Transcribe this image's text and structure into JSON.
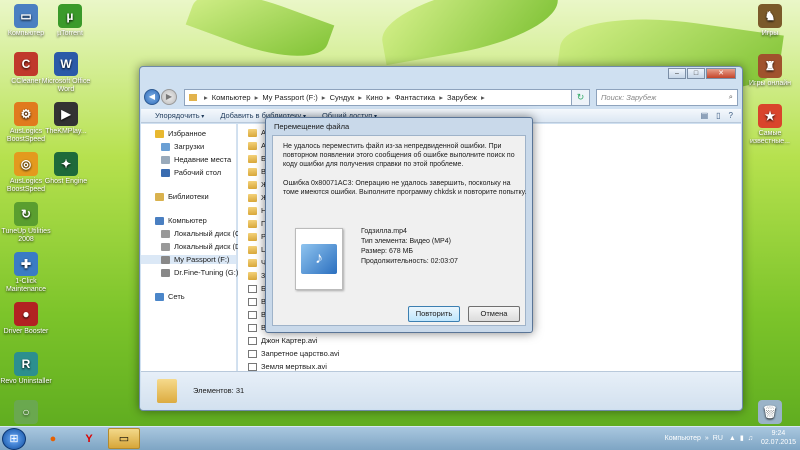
{
  "desktop": {
    "icons_left": [
      {
        "label": "Компьютер",
        "icon": "computer-icon"
      },
      {
        "label": "µTorrent",
        "icon": "utorrent-icon"
      },
      {
        "label": "CCleaner",
        "icon": "ccleaner-icon"
      },
      {
        "label": "Microsoft Office Word",
        "icon": "word-icon"
      },
      {
        "label": "AusLogics BoostSpeed",
        "icon": "boostspeed-icon"
      },
      {
        "label": "TheKMPlay...",
        "icon": "kmplayer-icon"
      },
      {
        "label": "AusLogics BoostSpeed",
        "icon": "boostspeed-icon"
      },
      {
        "label": "Ghost Engine",
        "icon": "ghost-icon"
      },
      {
        "label": "TuneUp Utilities 2008",
        "icon": "tuneup-icon"
      },
      {
        "label": "1-Click Maintenance",
        "icon": "maintenance-icon"
      },
      {
        "label": "Driver Booster",
        "icon": "driverbooster-icon"
      },
      {
        "label": "Revo Uninstaller",
        "icon": "revo-icon"
      }
    ],
    "icons_right": [
      {
        "label": "Игры",
        "icon": "games-icon"
      },
      {
        "label": "Игры онлайн",
        "icon": "games-online-icon"
      },
      {
        "label": "Самые известные...",
        "icon": "famous-icon"
      }
    ]
  },
  "explorer": {
    "breadcrumb": [
      "Компьютер",
      "My Passport (F:)",
      "Сундук",
      "Кино",
      "Фантастика",
      "Зарубеж"
    ],
    "search_placeholder": "Поиск: Зарубеж",
    "toolbar": [
      "Упорядочить",
      "Добавить в библиотеку",
      "Общий доступ"
    ],
    "nav": {
      "favorites": "Избранное",
      "downloads": "Загрузки",
      "recent": "Недавние места",
      "desktop": "Рабочий стол",
      "libraries": "Библиотеки",
      "computer": "Компьютер",
      "drive_c": "Локальный диск (C",
      "drive_d": "Локальный диск (D",
      "drive_f": "My Passport (F:)",
      "drive_g": "Dr.Fine-Tuning (G:)",
      "network": "Сеть"
    },
    "files_partial": [
      "Ав",
      "Аф",
      "Ба",
      "Во",
      "Жа",
      "Ж",
      "На",
      "Пл",
      "Ра",
      "Це",
      "Че",
      "300",
      "Бе",
      "Во",
      "Во",
      "Вр"
    ],
    "files": [
      "Джон Картер.avi",
      "Запретное царство.avi",
      "Земля мертвых.avi"
    ],
    "status": "Элементов: 31"
  },
  "dialog": {
    "title": "Перемещение файла",
    "message1": "Не удалось переместить файл из-за непредвиденной ошибки. При повторном появлении этого сообщения об ошибке выполните поиск по коду ошибки для получения справки по этой проблеме.",
    "message2": "Ошибка 0x80071AC3: Операцию не удалось завершить, поскольку на томе имеются ошибки. Выполните программу chkdsk и повторите попытку.",
    "file_name": "Годзилла.mp4",
    "file_type": "Тип элемента: Видео (MP4)",
    "file_size": "Размер: 678 МБ",
    "file_duration": "Продолжительность: 02:03:07",
    "retry": "Повторить",
    "cancel": "Отмена"
  },
  "taskbar": {
    "computer_label": "Компьютер",
    "lang": "RU",
    "time": "9:24",
    "date": "02.07.2015"
  }
}
